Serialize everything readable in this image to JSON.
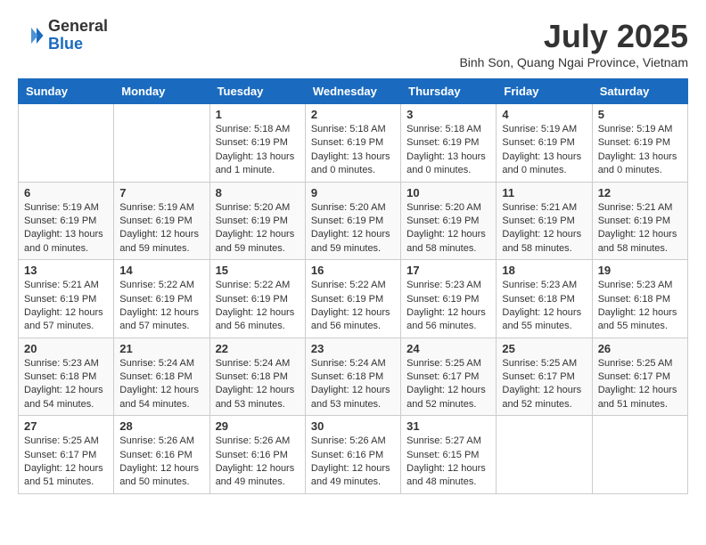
{
  "logo": {
    "general": "General",
    "blue": "Blue"
  },
  "title": "July 2025",
  "location": "Binh Son, Quang Ngai Province, Vietnam",
  "days_of_week": [
    "Sunday",
    "Monday",
    "Tuesday",
    "Wednesday",
    "Thursday",
    "Friday",
    "Saturday"
  ],
  "weeks": [
    [
      {
        "day": "",
        "info": ""
      },
      {
        "day": "",
        "info": ""
      },
      {
        "day": "1",
        "info": "Sunrise: 5:18 AM\nSunset: 6:19 PM\nDaylight: 13 hours and 1 minute."
      },
      {
        "day": "2",
        "info": "Sunrise: 5:18 AM\nSunset: 6:19 PM\nDaylight: 13 hours and 0 minutes."
      },
      {
        "day": "3",
        "info": "Sunrise: 5:18 AM\nSunset: 6:19 PM\nDaylight: 13 hours and 0 minutes."
      },
      {
        "day": "4",
        "info": "Sunrise: 5:19 AM\nSunset: 6:19 PM\nDaylight: 13 hours and 0 minutes."
      },
      {
        "day": "5",
        "info": "Sunrise: 5:19 AM\nSunset: 6:19 PM\nDaylight: 13 hours and 0 minutes."
      }
    ],
    [
      {
        "day": "6",
        "info": "Sunrise: 5:19 AM\nSunset: 6:19 PM\nDaylight: 13 hours and 0 minutes."
      },
      {
        "day": "7",
        "info": "Sunrise: 5:19 AM\nSunset: 6:19 PM\nDaylight: 12 hours and 59 minutes."
      },
      {
        "day": "8",
        "info": "Sunrise: 5:20 AM\nSunset: 6:19 PM\nDaylight: 12 hours and 59 minutes."
      },
      {
        "day": "9",
        "info": "Sunrise: 5:20 AM\nSunset: 6:19 PM\nDaylight: 12 hours and 59 minutes."
      },
      {
        "day": "10",
        "info": "Sunrise: 5:20 AM\nSunset: 6:19 PM\nDaylight: 12 hours and 58 minutes."
      },
      {
        "day": "11",
        "info": "Sunrise: 5:21 AM\nSunset: 6:19 PM\nDaylight: 12 hours and 58 minutes."
      },
      {
        "day": "12",
        "info": "Sunrise: 5:21 AM\nSunset: 6:19 PM\nDaylight: 12 hours and 58 minutes."
      }
    ],
    [
      {
        "day": "13",
        "info": "Sunrise: 5:21 AM\nSunset: 6:19 PM\nDaylight: 12 hours and 57 minutes."
      },
      {
        "day": "14",
        "info": "Sunrise: 5:22 AM\nSunset: 6:19 PM\nDaylight: 12 hours and 57 minutes."
      },
      {
        "day": "15",
        "info": "Sunrise: 5:22 AM\nSunset: 6:19 PM\nDaylight: 12 hours and 56 minutes."
      },
      {
        "day": "16",
        "info": "Sunrise: 5:22 AM\nSunset: 6:19 PM\nDaylight: 12 hours and 56 minutes."
      },
      {
        "day": "17",
        "info": "Sunrise: 5:23 AM\nSunset: 6:19 PM\nDaylight: 12 hours and 56 minutes."
      },
      {
        "day": "18",
        "info": "Sunrise: 5:23 AM\nSunset: 6:18 PM\nDaylight: 12 hours and 55 minutes."
      },
      {
        "day": "19",
        "info": "Sunrise: 5:23 AM\nSunset: 6:18 PM\nDaylight: 12 hours and 55 minutes."
      }
    ],
    [
      {
        "day": "20",
        "info": "Sunrise: 5:23 AM\nSunset: 6:18 PM\nDaylight: 12 hours and 54 minutes."
      },
      {
        "day": "21",
        "info": "Sunrise: 5:24 AM\nSunset: 6:18 PM\nDaylight: 12 hours and 54 minutes."
      },
      {
        "day": "22",
        "info": "Sunrise: 5:24 AM\nSunset: 6:18 PM\nDaylight: 12 hours and 53 minutes."
      },
      {
        "day": "23",
        "info": "Sunrise: 5:24 AM\nSunset: 6:18 PM\nDaylight: 12 hours and 53 minutes."
      },
      {
        "day": "24",
        "info": "Sunrise: 5:25 AM\nSunset: 6:17 PM\nDaylight: 12 hours and 52 minutes."
      },
      {
        "day": "25",
        "info": "Sunrise: 5:25 AM\nSunset: 6:17 PM\nDaylight: 12 hours and 52 minutes."
      },
      {
        "day": "26",
        "info": "Sunrise: 5:25 AM\nSunset: 6:17 PM\nDaylight: 12 hours and 51 minutes."
      }
    ],
    [
      {
        "day": "27",
        "info": "Sunrise: 5:25 AM\nSunset: 6:17 PM\nDaylight: 12 hours and 51 minutes."
      },
      {
        "day": "28",
        "info": "Sunrise: 5:26 AM\nSunset: 6:16 PM\nDaylight: 12 hours and 50 minutes."
      },
      {
        "day": "29",
        "info": "Sunrise: 5:26 AM\nSunset: 6:16 PM\nDaylight: 12 hours and 49 minutes."
      },
      {
        "day": "30",
        "info": "Sunrise: 5:26 AM\nSunset: 6:16 PM\nDaylight: 12 hours and 49 minutes."
      },
      {
        "day": "31",
        "info": "Sunrise: 5:27 AM\nSunset: 6:15 PM\nDaylight: 12 hours and 48 minutes."
      },
      {
        "day": "",
        "info": ""
      },
      {
        "day": "",
        "info": ""
      }
    ]
  ]
}
